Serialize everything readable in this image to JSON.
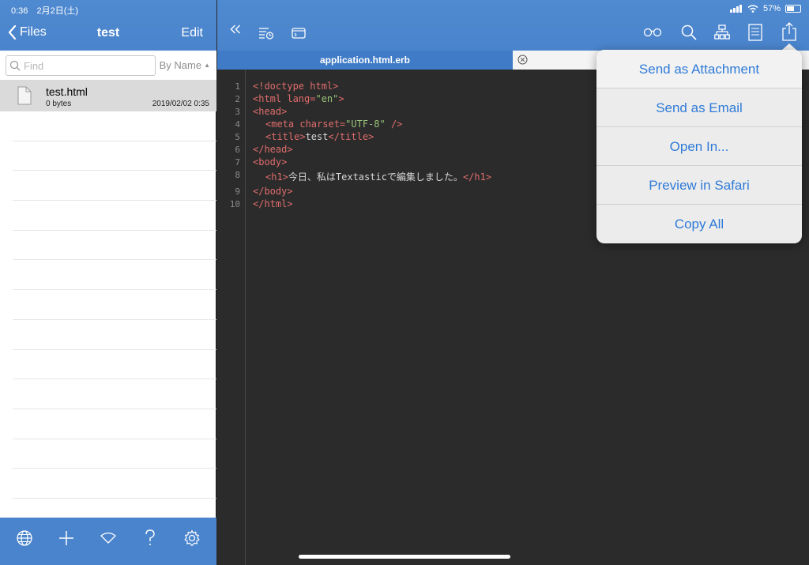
{
  "status_bar": {
    "time": "0:36",
    "date": "2月2日(土)",
    "battery": "57%",
    "battery_fraction": 0.57
  },
  "sidebar": {
    "back_label": "Files",
    "title": "test",
    "edit_label": "Edit",
    "search_placeholder": "Find",
    "sort_label": "By Name",
    "files": [
      {
        "name": "test.html",
        "size": "0 bytes",
        "date": "2019/02/02 0:35"
      }
    ],
    "footer_icons": [
      "globe-icon",
      "plus-icon",
      "wifi-icon",
      "help-icon",
      "gear-icon"
    ]
  },
  "toolbar": {
    "left_icons": [
      "collapse-icon",
      "recent-files-icon",
      "terminal-icon"
    ],
    "right_icons": [
      "glasses-icon",
      "search-icon",
      "sitemap-icon",
      "document-icon",
      "share-icon"
    ]
  },
  "tabs": [
    {
      "label": "application.html.erb",
      "active": true
    },
    {
      "label": "",
      "active": false
    }
  ],
  "editor": {
    "line_numbers": [
      "1",
      "2",
      "3",
      "4",
      "5",
      "6",
      "7",
      "8",
      "9",
      "10"
    ],
    "lines": {
      "l1": "<!doctype html>",
      "l2_tag": "<html ",
      "l2_attr": "lang=",
      "l2_str": "\"en\"",
      "l2_close": ">",
      "l3": "<head>",
      "l4_tag": "<meta ",
      "l4_attr": "charset=",
      "l4_str": "\"UTF-8\"",
      "l4_close": " />",
      "l5_open": "<title>",
      "l5_text": "test",
      "l5_close": "</title>",
      "l6": "</head>",
      "l7": "<body>",
      "l8_open": "<h1>",
      "l8_text": "今日、私はTextasticで編集しました。",
      "l8_close": "</h1>",
      "l9": "</body>",
      "l10": "</html>"
    }
  },
  "share_menu": {
    "items": [
      "Send as Attachment",
      "Send as Email",
      "Open In...",
      "Preview in Safari",
      "Copy All"
    ]
  },
  "colors": {
    "header_blue": "#4a84cc",
    "editor_bg": "#2b2b2b",
    "tag_red": "#e06c6c",
    "string_green": "#98c379",
    "link_blue": "#2f7bd8"
  }
}
